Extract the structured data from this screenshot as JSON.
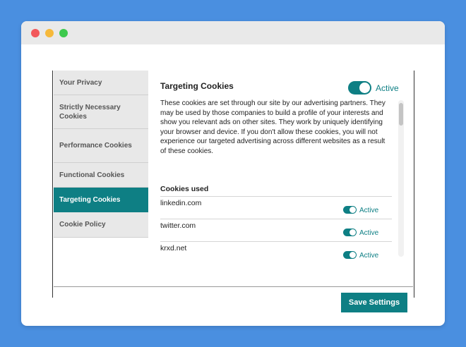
{
  "window": {
    "controls": [
      "close",
      "minimize",
      "maximize"
    ],
    "colors": {
      "background": "#4a8fe0",
      "accent": "#0e7f84",
      "close": "#f2575a",
      "minimize": "#f6b93b",
      "maximize": "#3ec94d"
    }
  },
  "sidebar": {
    "items": [
      {
        "label": "Your Privacy",
        "active": false
      },
      {
        "label": "Strictly Necessary Cookies",
        "active": false
      },
      {
        "label": "Performance Cookies",
        "active": false
      },
      {
        "label": "Functional Cookies",
        "active": false
      },
      {
        "label": "Targeting Cookies",
        "active": true
      },
      {
        "label": "Cookie Policy",
        "active": false
      }
    ]
  },
  "main": {
    "heading": "Targeting Cookies",
    "toggle_state": "on",
    "status_label": "Active",
    "description": "These cookies are set through our site by our advertising partners. They may be used by those companies to build a profile of your interests and show you relevant ads on other sites. They work by uniquely identifying your browser and device. If you don't allow these cookies, you will not experience our targeted advertising across different websites as a result of these cookies.",
    "cookies_used_label": "Cookies used",
    "cookies": [
      {
        "domain": "linkedin.com",
        "status": "Active",
        "toggle_state": "on"
      },
      {
        "domain": "twitter.com",
        "status": "Active",
        "toggle_state": "on"
      },
      {
        "domain": "krxd.net",
        "status": "Active",
        "toggle_state": "on"
      }
    ]
  },
  "footer": {
    "save_label": "Save Settings"
  }
}
